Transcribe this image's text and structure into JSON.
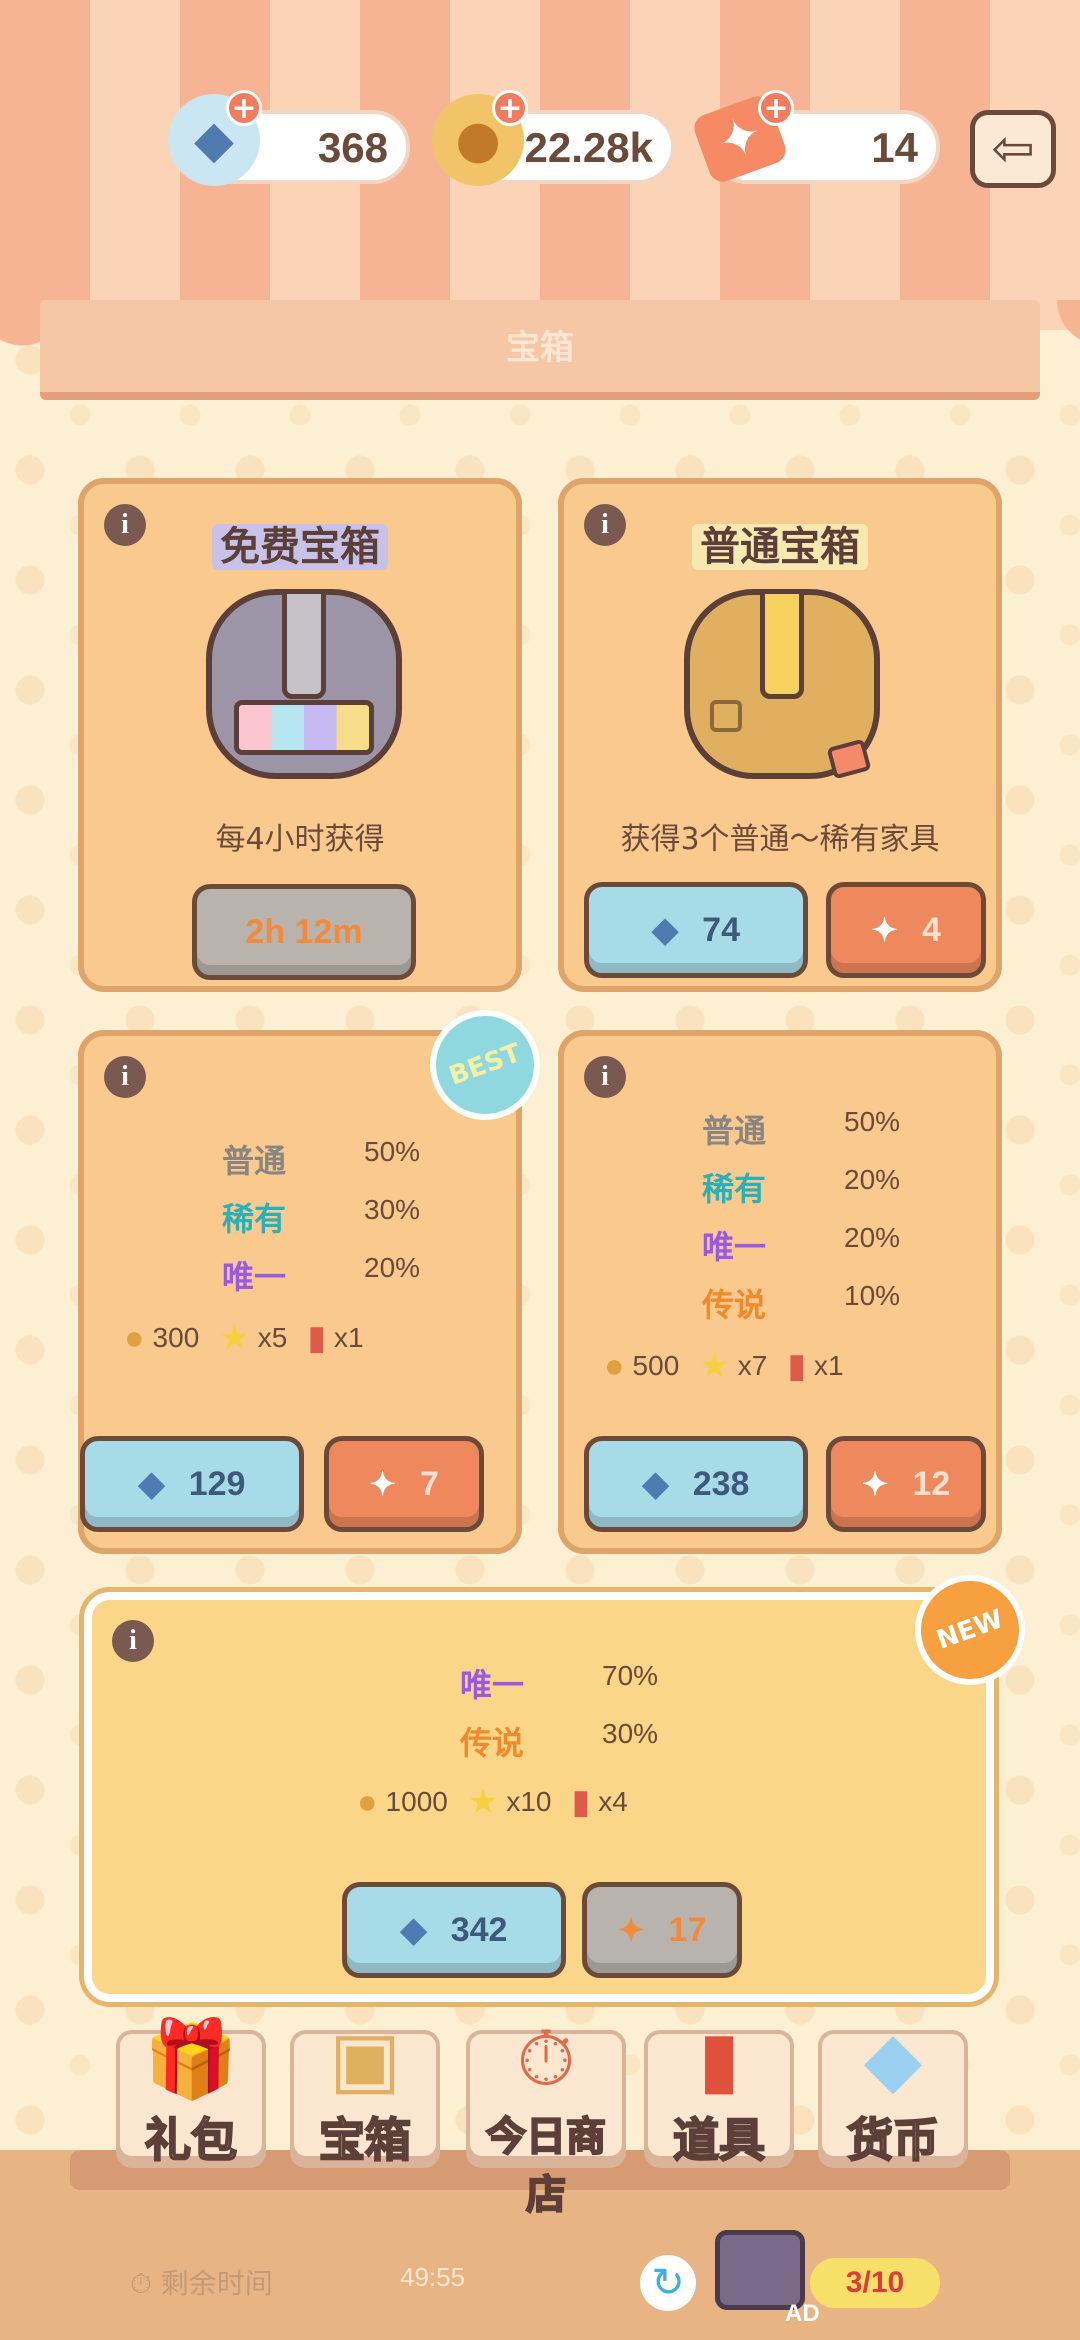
{
  "header": {
    "currencies": [
      {
        "icon": "gem-icon",
        "value": "368"
      },
      {
        "icon": "coin-icon",
        "value": "22.28k"
      },
      {
        "icon": "ticket-icon",
        "value": "14"
      }
    ],
    "board_title": "宝箱"
  },
  "cards": {
    "free": {
      "title": "免费宝箱",
      "desc": "每4小时获得",
      "timer": "2h 12m"
    },
    "normal": {
      "title": "普通宝箱",
      "desc": "获得3个普通～稀有家具",
      "gem_price": "74",
      "ticket_price": "4"
    },
    "best": {
      "badge": "BEST",
      "odds": [
        {
          "rarity": "普通",
          "pct": "50%"
        },
        {
          "rarity": "稀有",
          "pct": "30%"
        },
        {
          "rarity": "唯一",
          "pct": "20%"
        }
      ],
      "rewards": {
        "coins": "300",
        "stars": "x5",
        "cans": "x1"
      },
      "gem_price": "129",
      "ticket_price": "7"
    },
    "legend": {
      "odds": [
        {
          "rarity": "普通",
          "pct": "50%"
        },
        {
          "rarity": "稀有",
          "pct": "20%"
        },
        {
          "rarity": "唯一",
          "pct": "20%"
        },
        {
          "rarity": "传说",
          "pct": "10%"
        }
      ],
      "rewards": {
        "coins": "500",
        "stars": "x7",
        "cans": "x1"
      },
      "gem_price": "238",
      "ticket_price": "12"
    },
    "premium": {
      "badge": "NEW",
      "odds": [
        {
          "rarity": "唯一",
          "pct": "70%"
        },
        {
          "rarity": "传说",
          "pct": "30%"
        }
      ],
      "rewards": {
        "coins": "1000",
        "stars": "x10",
        "cans": "x4"
      },
      "gem_price": "342",
      "ticket_price": "17"
    }
  },
  "tabs": [
    {
      "label": "礼包",
      "icon": "gift-icon"
    },
    {
      "label": "宝箱",
      "icon": "chest-icon"
    },
    {
      "label": "今日商店",
      "icon": "stopwatch-icon"
    },
    {
      "label": "道具",
      "icon": "can-icon"
    },
    {
      "label": "货币",
      "icon": "gem-icon"
    }
  ],
  "footer": {
    "timer_label": "剩余时间",
    "timer_value": "49:55",
    "ad_label": "AD",
    "ad_count": "3/10"
  }
}
